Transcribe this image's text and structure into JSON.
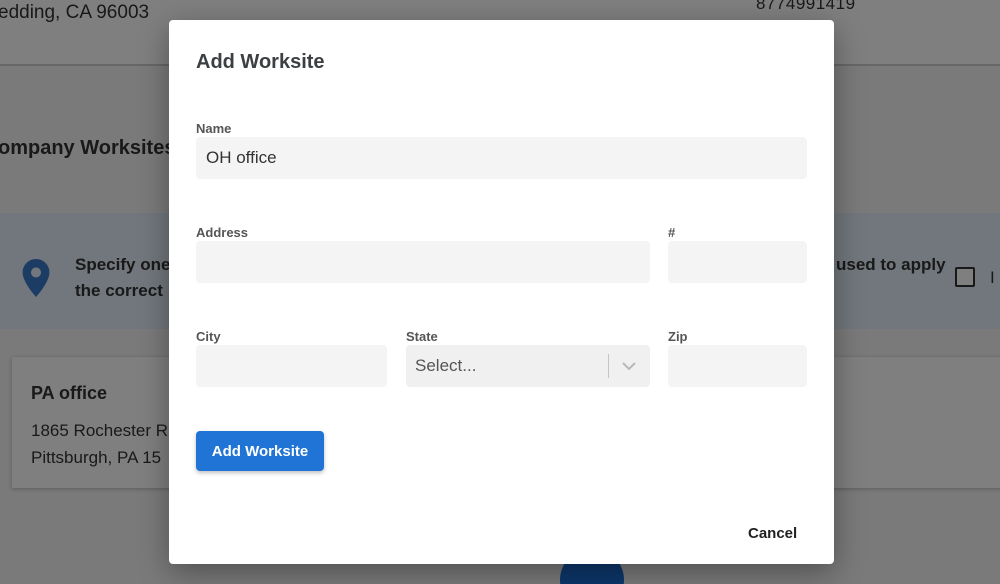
{
  "background": {
    "address_line": "edding, CA 96003",
    "phone": "8774991419",
    "section_title": "ompany Worksites",
    "info_line1": "Specify one",
    "info_line2": "the correct",
    "info_right": "used to apply",
    "info_checkbox_label": "I",
    "card": {
      "title": "PA office",
      "street": "1865 Rochester R",
      "city_line": "Pittsburgh, PA 15"
    }
  },
  "modal": {
    "title": "Add Worksite",
    "fields": {
      "name_label": "Name",
      "name_value": "OH office",
      "address_label": "Address",
      "address_value": "",
      "number_label": "#",
      "number_value": "",
      "city_label": "City",
      "city_value": "",
      "state_label": "State",
      "state_placeholder": "Select...",
      "zip_label": "Zip",
      "zip_value": ""
    },
    "add_button": "Add Worksite",
    "cancel_button": "Cancel"
  },
  "colors": {
    "primary": "#1f74d6",
    "info_banner": "#e3eef9",
    "pin": "#3b78c9"
  },
  "icons": {
    "pin": "map-pin-icon",
    "chevron": "chevron-down-icon"
  }
}
